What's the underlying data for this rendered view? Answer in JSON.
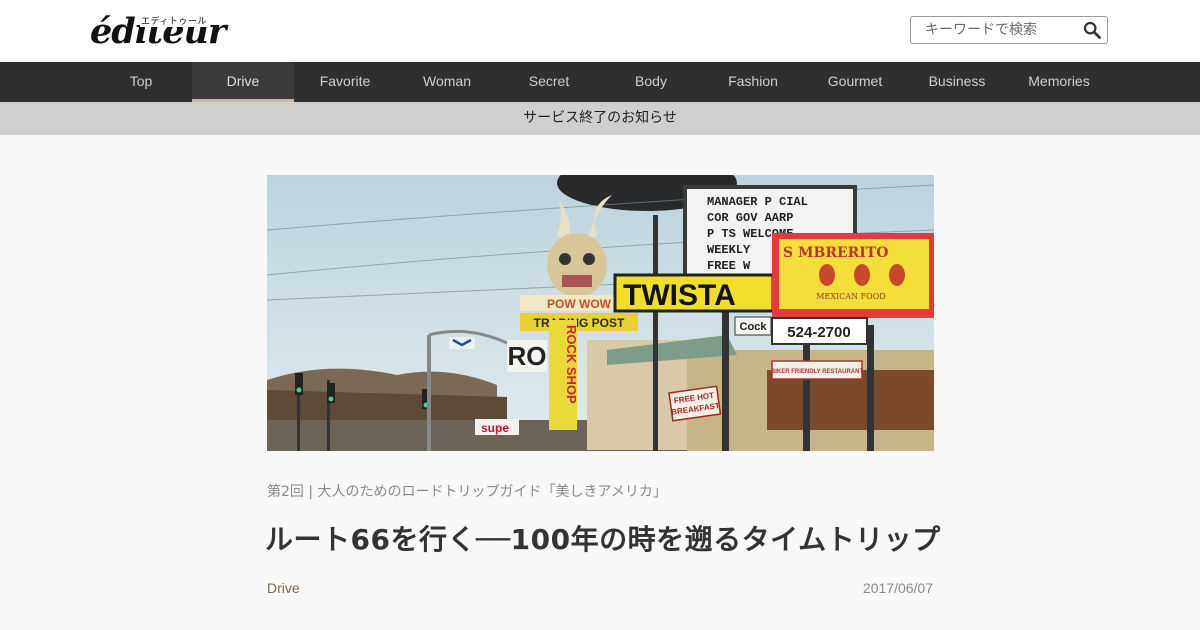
{
  "header": {
    "logo_text": "éditeur",
    "logo_sub": "エディトゥール",
    "search_placeholder": "キーワードで検索"
  },
  "nav": {
    "items": [
      {
        "label": "Top"
      },
      {
        "label": "Drive",
        "active": true
      },
      {
        "label": "Favorite"
      },
      {
        "label": "Woman"
      },
      {
        "label": "Secret"
      },
      {
        "label": "Body"
      },
      {
        "label": "Fashion"
      },
      {
        "label": "Gourmet"
      },
      {
        "label": "Business"
      },
      {
        "label": "Memories"
      }
    ]
  },
  "notice": {
    "text": "サービス終了のお知らせ"
  },
  "hero": {
    "signs": {
      "manager": [
        "MANAGER  P CIAL",
        "COR  GOV  AARP",
        "P TS  WELCOME",
        "WEEKLY",
        "FREE W"
      ],
      "sombrero": "S MBRERITO",
      "mexican": "MEXICAN FOOD",
      "phone": "524-2700",
      "restaurant": "BIKER FRIENDLY RESTAURANT",
      "twista": "TWISTA",
      "powwow": "POW WOW",
      "trading": "TRADING POST",
      "rock_shop": "ROCK SHOP",
      "free_hot": "FREE HOT",
      "breakfast": "BREAKFAST",
      "r_letters": "RO",
      "cock": "Cock",
      "super": "supe"
    }
  },
  "article": {
    "series": "第2回 | 大人のためのロードトリップガイド「美しきアメリカ」",
    "title": "ルート66を行く──100年の時を遡るタイムトリップ",
    "category": "Drive",
    "date": "2017/06/07"
  },
  "colors": {
    "nav_bg": "#2f2f2f",
    "nav_active_underline": "#c9b89a",
    "notice_bg": "#cfcfcf",
    "category": "#7a6a4a"
  }
}
